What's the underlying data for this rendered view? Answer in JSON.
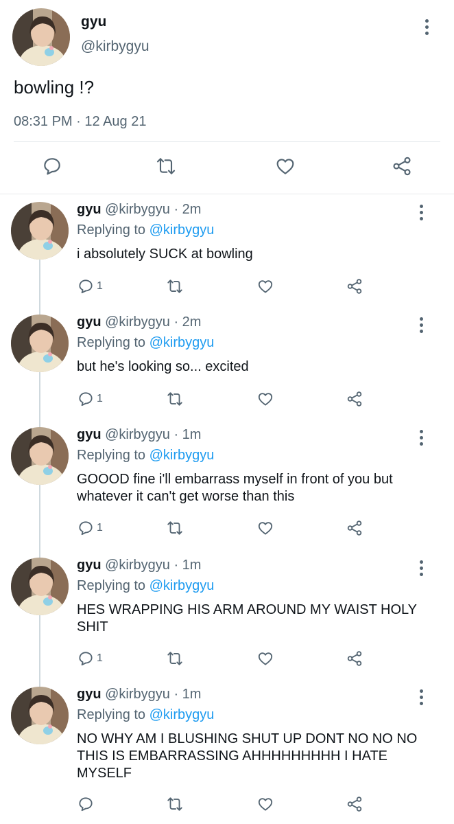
{
  "main_tweet": {
    "name": "gyu",
    "handle": "@kirbygyu",
    "text": "bowling !?",
    "timestamp": "08:31 PM · 12 Aug 21",
    "actions": [
      "reply-icon",
      "retweet-icon",
      "like-icon",
      "share-icon"
    ]
  },
  "replies": [
    {
      "name": "gyu",
      "handle": "@kirbygyu · 2m",
      "replying_prefix": "Replying to",
      "replying_to": "@kirbygyu",
      "text": "i absolutely SUCK at bowling",
      "reply_count": "1"
    },
    {
      "name": "gyu",
      "handle": "@kirbygyu · 2m",
      "replying_prefix": "Replying to",
      "replying_to": "@kirbygyu",
      "text": "but he's looking so... excited",
      "reply_count": "1"
    },
    {
      "name": "gyu",
      "handle": "@kirbygyu · 1m",
      "replying_prefix": "Replying to",
      "replying_to": "@kirbygyu",
      "text": "GOOOD fine i'll embarrass myself in front of you but whatever it can't get worse than this",
      "reply_count": "1"
    },
    {
      "name": "gyu",
      "handle": "@kirbygyu · 1m",
      "replying_prefix": "Replying to",
      "replying_to": "@kirbygyu",
      "text": "HES WRAPPING HIS ARM AROUND MY WAIST HOLY SHIT",
      "reply_count": "1"
    },
    {
      "name": "gyu",
      "handle": "@kirbygyu · 1m",
      "replying_prefix": "Replying to",
      "replying_to": "@kirbygyu",
      "text": "NO WHY AM I BLUSHING SHUT UP DONT NO NO NO THIS IS EMBARRASSING AHHHHHHHHH I HATE MYSELF",
      "reply_count": ""
    }
  ],
  "colors": {
    "accent": "#1d9bf0",
    "secondary_text": "#536471",
    "primary_text": "#0f1419",
    "icon": "#536471"
  }
}
